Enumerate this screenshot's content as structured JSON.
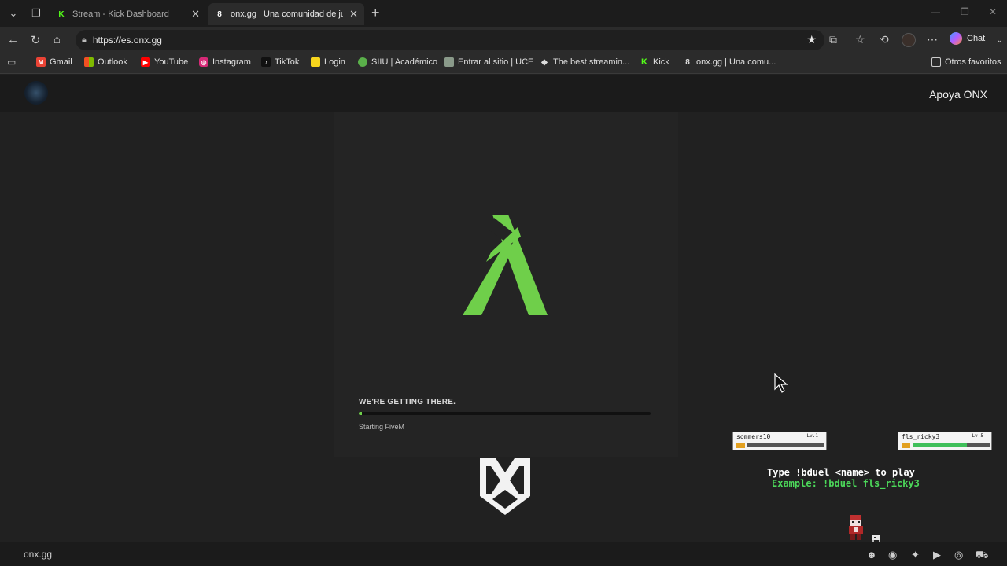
{
  "browser": {
    "tabs": [
      {
        "title": "Stream - Kick Dashboard",
        "favicon": "kick-icon",
        "active": false
      },
      {
        "title": "onx.gg | Una comunidad de juego",
        "favicon": "onx-icon",
        "active": true
      }
    ],
    "address": "https://es.onx.gg",
    "chat_label": "Chat",
    "bookmarks": [
      {
        "label": "Gmail",
        "icon": "gmail-icon",
        "color": "#ea4335"
      },
      {
        "label": "Outlook",
        "icon": "windows-icon",
        "color": "#f25022"
      },
      {
        "label": "YouTube",
        "icon": "youtube-icon",
        "color": "#ff0000"
      },
      {
        "label": "Instagram",
        "icon": "instagram-icon",
        "color": "#d62976"
      },
      {
        "label": "TikTok",
        "icon": "tiktok-icon",
        "color": "#111111"
      },
      {
        "label": "Login",
        "icon": "login-icon",
        "color": "#f7d51d"
      },
      {
        "label": "SIIU | Académico",
        "icon": "siiu-icon",
        "color": "#5ab04a"
      },
      {
        "label": "Entrar al sitio | UCE",
        "icon": "uce-icon",
        "color": "#8a9a8a"
      },
      {
        "label": "The best streamin...",
        "icon": "streaming-icon",
        "color": "#dddddd"
      },
      {
        "label": "Kick",
        "icon": "kick-icon",
        "color": "#53fc18"
      },
      {
        "label": "onx.gg | Una comu...",
        "icon": "onx-icon",
        "color": "#6a5acd"
      }
    ],
    "other_favorites": "Otros favoritos"
  },
  "site": {
    "support_link": "Apoya ONX",
    "footer_brand": "onx.gg",
    "social_icons": [
      "discord-alt-icon",
      "discord-icon",
      "twitter-icon",
      "youtube-icon",
      "instagram-icon",
      "shop-icon"
    ]
  },
  "loader": {
    "status_title": "WE'RE GETTING THERE.",
    "status_text": "Starting FiveM",
    "progress": 0.01,
    "accent": "#6fcf4a"
  },
  "duel": {
    "player1": {
      "name": "sommers10",
      "level": "Lv.1",
      "hp_label": "HP:",
      "hp": 0
    },
    "player2": {
      "name": "fls_ricky3",
      "level": "Lv.5",
      "hp_label": "HP:",
      "hp": 0.7
    },
    "instruction": "Type !bduel <name> to play",
    "example": "Example: !bduel fls_ricky3"
  }
}
